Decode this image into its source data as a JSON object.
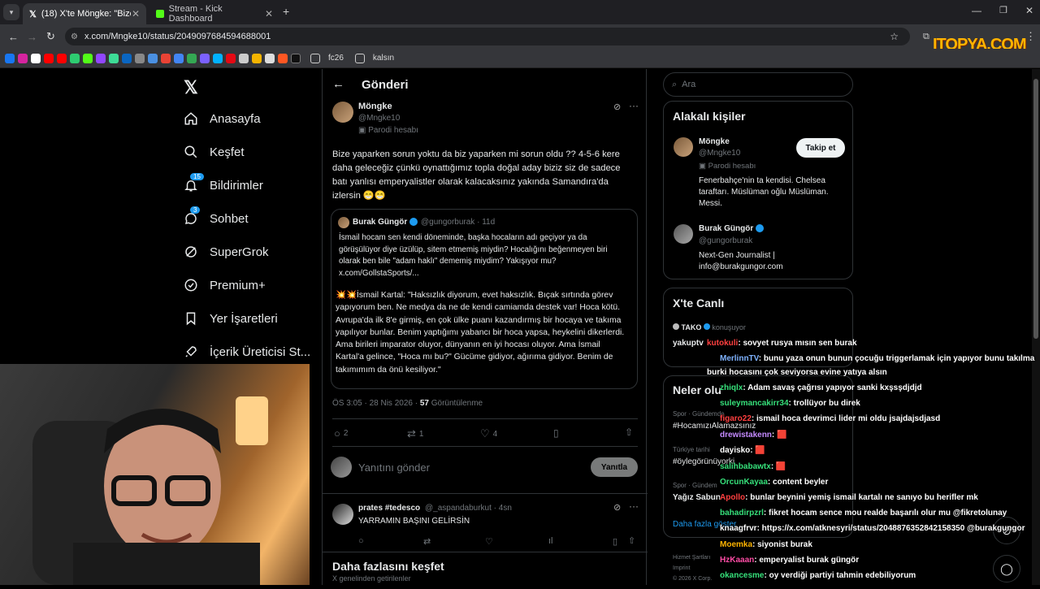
{
  "browser": {
    "tabs": [
      {
        "title": "(18) X'te Möngke: \"Bize yaparke"
      },
      {
        "title": "Stream - Kick Dashboard"
      }
    ],
    "url": "x.com/Mngke10/status/2049097684594688001",
    "bookmarks": [
      "fc26",
      "kalsın"
    ],
    "watermark": "ITOPYA.COM"
  },
  "nav": {
    "items": [
      {
        "label": "Anasayfa",
        "icon": "home-icon"
      },
      {
        "label": "Keşfet",
        "icon": "search-icon"
      },
      {
        "label": "Bildirimler",
        "icon": "bell-icon",
        "badge": "15"
      },
      {
        "label": "Sohbet",
        "icon": "chat-icon",
        "badge": "3"
      },
      {
        "label": "SuperGrok",
        "icon": "grok-icon"
      },
      {
        "label": "Premium+",
        "icon": "premium-icon"
      },
      {
        "label": "Yer İşaretleri",
        "icon": "bookmark-icon"
      },
      {
        "label": "İçerik Üreticisi St...",
        "icon": "rocket-icon"
      }
    ]
  },
  "post": {
    "header_title": "Gönderi",
    "author_name": "Möngke",
    "author_handle": "@Mngke10",
    "parody_label": "Parodi hesabı",
    "text": "Bize yaparken sorun yoktu da biz yaparken mi sorun oldu ?? 4-5-6 kere daha geleceğiz çünkü oynattığımız topla doğal aday biziz siz de sadece batı yanlısı emperyalistler olarak kalacaksınız yakında Samandıra'da izlersin 😁😁",
    "quote": {
      "author_name": "Burak Güngör",
      "author_handle": "@gungorburak · 11d",
      "text1": "İsmail hocam sen kendi döneminde, başka hocaların adı geçiyor ya da görüşülüyor diye üzülüp, sitem etmemiş miydin? Hocalığını beğenmeyen biri olarak ben bile \"adam haklı\" dememiş miydim? Yakışıyor mu? x.com/GollstaSports/...",
      "text2": "💥💥İsmail Kartal: \"Haksızlık diyorum, evet haksızlık. Bıçak sırtında görev yapıyorum ben. Ne medya da ne de kendi camiamda destek var! Hoca kötü. Avrupa'da ilk 8'e girmiş, en çok ülke puanı kazandırmış bir hocaya ve takıma yapılıyor bunlar. Benim yaptığımı yabancı bir hoca yapsa, heykelini dikerlerdi. Ama birileri imparator oluyor, dünyanın en iyi hocası oluyor. Ama İsmail Kartal'a gelince, \"Hoca mı bu?\" Gücüme gidiyor, ağırıma gidiyor. Benim de takımımım da önü kesiliyor.\""
    },
    "meta_time": "ÖS 3:05 · 28 Nis 2026 · ",
    "meta_views": "57",
    "meta_views_label": " Görüntülenme",
    "reply_count": "2",
    "repost_count": "1",
    "like_count": "4",
    "reply_placeholder": "Yanıtını gönder",
    "reply_button": "Yanıtla"
  },
  "reply": {
    "author_name": "prates #tedesco",
    "author_handle": "@_aspandaburkut · 4sn",
    "text": "YARRAMIN BAŞINI GELİRSİN"
  },
  "discover": {
    "title": "Daha fazlasını keşfet",
    "subtitle": "X genelinden getirilenler"
  },
  "sidebar": {
    "search_placeholder": "Ara",
    "related_title": "Alakalı kişiler",
    "people": [
      {
        "name": "Möngke",
        "handle": "@Mngke10",
        "parody": "Parodi hesabı",
        "bio": "Fenerbahçe'nin ta kendisi. Chelsea taraftarı. Müslüman oğlu Müslüman. Messi.",
        "follow": "Takip et"
      },
      {
        "name": "Burak Güngör",
        "handle": "@gungorburak",
        "bio": "Next-Gen Journalist | info@burakgungor.com"
      }
    ],
    "live_title": "X'te Canlı",
    "live_host": "TAKO",
    "live_status": "konuşuyor",
    "live_name": "yakuptv",
    "trends_title": "Neler olu",
    "trends": [
      {
        "cat": "Spor · Gündemde",
        "tag": "#HocamızıAlamazsınız"
      },
      {
        "cat": "Türkiye tarihi",
        "tag": "#öylegörünüyorki"
      },
      {
        "cat": "Spor · Gündem",
        "tag": "Yağız Sabun"
      }
    ],
    "more": "Daha fazla göster",
    "footer1": "Hizmet Şartları",
    "footer2": "Imprint",
    "footer3": "© 2026 X Corp."
  },
  "chat": [
    {
      "user": "kutokuli",
      "color": "#ff4040",
      "msg": ": sovyet rusya mısın sen burak"
    },
    {
      "user": "MerlinnTV",
      "color": "#7fb3ff",
      "msg": ": bunu yaza onun bunun çocuğu triggerlamak için yapıyor bunu takılma"
    },
    {
      "user": "",
      "color": "#ffffff",
      "msg": "burki hocasını çok seviyorsa evine yatıya alsın"
    },
    {
      "user": "zhiqlx",
      "color": "#36e07a",
      "msg": ": Adam savaş çağrısı yapıyor sanki kxşsşdjdjd"
    },
    {
      "user": "suleymancakirr34",
      "color": "#36e07a",
      "msg": ": trollüyor bu direk"
    },
    {
      "user": "figaro22",
      "color": "#ff4040",
      "msg": ": ismail hoca devrimci lider mi oldu jsajdajsdjasd"
    },
    {
      "user": "drewistakenn",
      "color": "#c58bff",
      "msg": ": 🟥"
    },
    {
      "user": "dayisko",
      "color": "#ffffff",
      "msg": ": 🟥"
    },
    {
      "user": "salihbabawtx",
      "color": "#36e07a",
      "msg": ": 🟥"
    },
    {
      "user": "OrcunKayaa",
      "color": "#36e07a",
      "msg": ": content beyler"
    },
    {
      "user": "Apollo",
      "color": "#ff4040",
      "msg": ": bunlar beynini yemiş ismail kartalı ne sanıyo bu herifler mk"
    },
    {
      "user": "bahadirpzrl",
      "color": "#36e07a",
      "msg": ": fikret hocam sence mou realde başarılı olur mu @fikretolunay"
    },
    {
      "user": "knaagfrvr",
      "color": "#ffffff",
      "msg": ": https://x.com/atknesyri/status/2048876352842158350 @burakgungor"
    },
    {
      "user": "Moemka",
      "color": "#ffb400",
      "msg": ": siyonist burak"
    },
    {
      "user": "HzKaaan",
      "color": "#ff4da6",
      "msg": ": emperyalist burak güngör"
    },
    {
      "user": "okancesme",
      "color": "#36e07a",
      "msg": ": oy verdiği partiyi tahmin edebiliyorum"
    }
  ]
}
